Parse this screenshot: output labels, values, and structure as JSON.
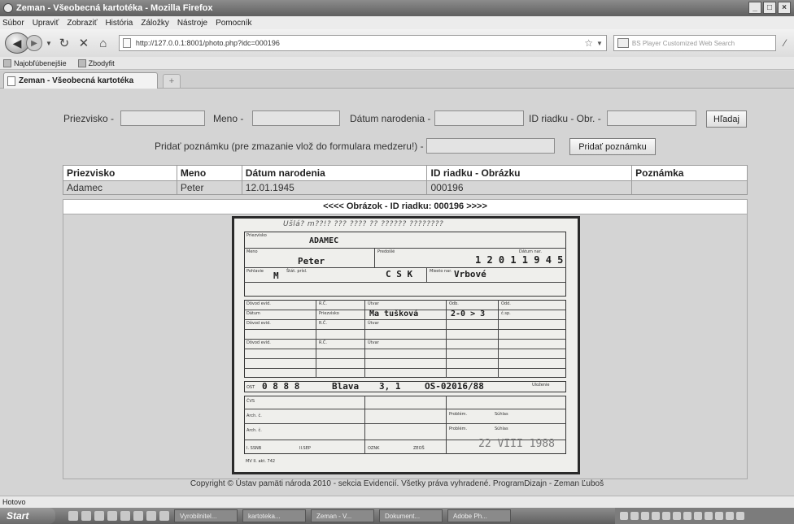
{
  "window": {
    "title": "Zeman - Všeobecná kartotéka - Mozilla Firefox"
  },
  "menu": [
    "Súbor",
    "Upraviť",
    "Zobraziť",
    "História",
    "Záložky",
    "Nástroje",
    "Pomocník"
  ],
  "navigation": {
    "url": "http://127.0.0.1:8001/photo.php?idc=000196",
    "search_placeholder": "BS Player Customized Web Search"
  },
  "bookmarks": [
    "Najobľúbenejšie",
    "Zbodyfit"
  ],
  "tab": {
    "label": "Zeman - Všeobecná kartotéka",
    "new_tab": "+"
  },
  "search": {
    "surname_label": "Priezvisko -",
    "name_label": "Meno -",
    "dob_label": "Dátum narodenia -",
    "id_label": "ID riadku - Obr. -",
    "search_button": "Hľadaj",
    "note_label": "Pridať poznámku (pre zmazanie vlož do formulara medzeru!) -",
    "note_button": "Pridať poznámku"
  },
  "results": {
    "headers": [
      "Priezvisko",
      "Meno",
      "Dátum narodenia",
      "ID riadku - Obrázku",
      "Poznámka"
    ],
    "rows": [
      [
        "Adamec",
        "Peter",
        "12.01.1945",
        "000196",
        ""
      ]
    ]
  },
  "image_panel": {
    "header": "<<<< Obrázok - ID riadku: 000196 >>>>"
  },
  "card": {
    "scribble": "Ušlá? m??!? ??? ???? ?? ?????? ????????",
    "surname_caption": "Priezvisko",
    "surname": "ADAMEC",
    "name_caption": "Meno",
    "name": "Peter",
    "prev_name_caption": "Predošlé",
    "birth_caption": "Dátum nar.",
    "birth_digits": "1 2 0 1 1 9 4 5",
    "sex_caption": "Pohlavie",
    "sex": "M",
    "nationality_caption": "Štát. prísl.",
    "nationality": "C S K",
    "birthplace_caption": "Miesto nar.",
    "birthplace": "Vrbové",
    "partner_row_caption": "Dôvod evid.",
    "rc_caption": "R.Č.",
    "uvar_caption": "Útvar",
    "odb_caption": "Odb.",
    "odd_caption": "Odd.",
    "datum_caption": "Dátum",
    "priezvisko_caption": "Priezvisko",
    "partner_name": "Ma tušková",
    "partner_code": "2-0 > 3",
    "cp_caption": "č.sp.",
    "file_prefix": "OST",
    "file_no": "0 8 8 8",
    "file_city": "Blava",
    "file_num2": "3, 1",
    "file_ref": "OS-02016/88",
    "ulozenie_caption": "Uloženie",
    "cvs_caption": "ČVS",
    "arch1_caption": "Arch. č.",
    "arch2_caption": "Arch. č.",
    "problem_caption": "Problém.",
    "suhlas_caption": "Súhlas",
    "bottom_caption_1": "I. SSNB",
    "bottom_caption_2": "II.SEP",
    "bottom_caption_3": "OZNK",
    "bottom_caption_4": "ZEOŠ",
    "form_code": "MV II. akt. 742",
    "stamp": "22 VIII 1988"
  },
  "footer": {
    "copyright": "Copyright © Ústav pamäti národa 2010 - sekcia Evidencií. Všetky práva vyhradené. ProgramDizajn - Zeman Ľuboš"
  },
  "status": {
    "text": "Hotovo"
  },
  "taskbar": {
    "start": "Start",
    "tasks": [
      "Vyrobilnitel...",
      "kartoteka...",
      "Zeman - V...",
      "Dokument...",
      "Adobe Ph..."
    ]
  }
}
